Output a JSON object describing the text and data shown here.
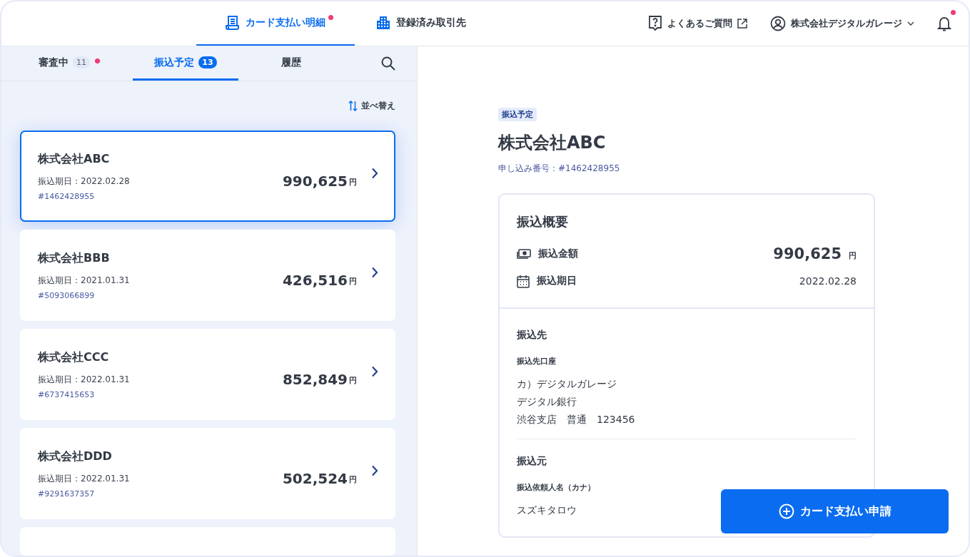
{
  "nav": {
    "tabs": [
      {
        "kind": "statement",
        "label": "カード支払い明細",
        "selected": true,
        "dot": true
      },
      {
        "kind": "partners",
        "label": "登録済み取引先",
        "selected": false,
        "dot": false
      }
    ],
    "help_link": "よくあるご質問",
    "account_name": "株式会社デジタルガレージ",
    "notification_dot": true
  },
  "list_tabs": [
    {
      "label": "審査中",
      "count": "11",
      "selected": false,
      "dot": true
    },
    {
      "label": "振込予定",
      "count": "13",
      "selected": true,
      "dot": false
    },
    {
      "label": "履歴",
      "selected": false,
      "dot": false
    }
  ],
  "sort_label": "並べ替え",
  "cards": [
    {
      "name": "株式会社ABC",
      "due": "振込期日：2022.02.28",
      "number": "#1462428955",
      "amount": "990,625",
      "unit": "円",
      "selected": true
    },
    {
      "name": "株式会社BBB",
      "due": "振込期日：2021.01.31",
      "number": "#5093066899",
      "amount": "426,516",
      "unit": "円",
      "selected": false
    },
    {
      "name": "株式会社CCC",
      "due": "振込期日：2022.01.31",
      "number": "#6737415653",
      "amount": "852,849",
      "unit": "円",
      "selected": false
    },
    {
      "name": "株式会社DDD",
      "due": "振込期日：2022.01.31",
      "number": "#9291637357",
      "amount": "502,524",
      "unit": "円",
      "selected": false
    }
  ],
  "detail": {
    "status_badge": "振込予定",
    "title": "株式会社ABC",
    "application_number": "申し込み番号：#1462428955",
    "summary": {
      "heading": "振込概要",
      "rows": [
        {
          "kind": "amount",
          "label": "振込金額",
          "value": "990,625",
          "unit": "円"
        },
        {
          "kind": "date",
          "label": "振込期日",
          "value": "2022.02.28"
        }
      ]
    },
    "payee": {
      "heading": "振込先",
      "field_label": "振込先口座",
      "lines": [
        "カ）デジタルガレージ",
        "デジタル銀行",
        "渋谷支店　普通　123456"
      ]
    },
    "payer": {
      "heading": "振込元",
      "field_label": "振込依頼人名（カナ）",
      "value": "スズキタロウ"
    }
  },
  "action_button": "カード支払い申請"
}
